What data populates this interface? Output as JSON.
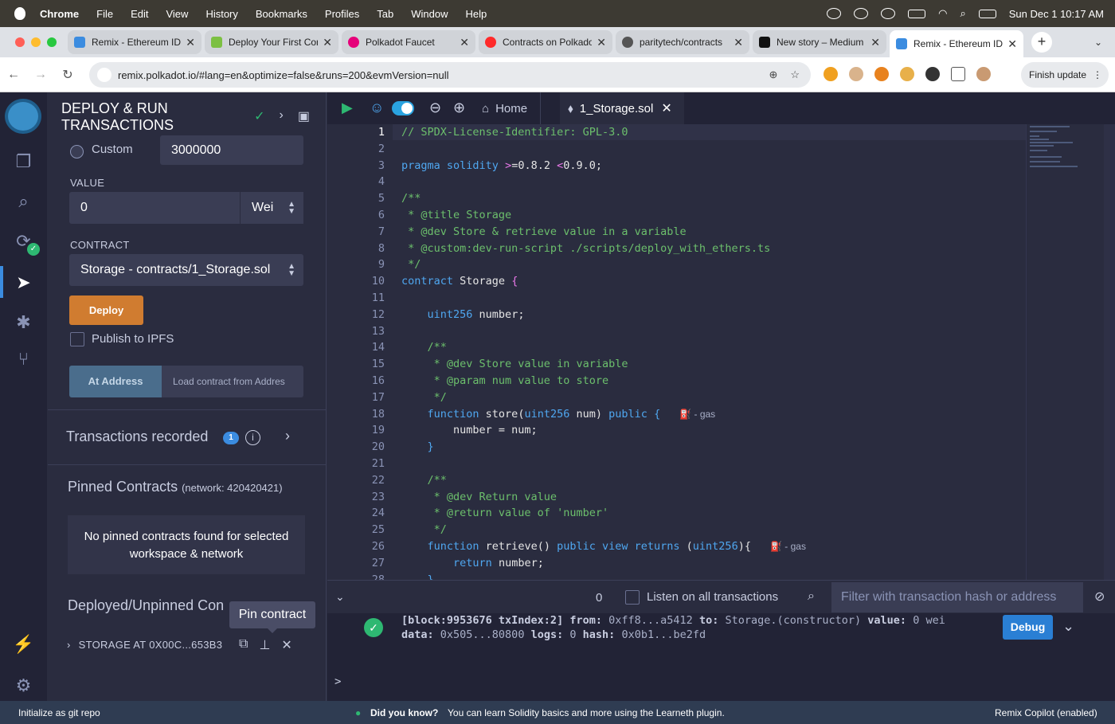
{
  "menubar": {
    "app": "Chrome",
    "items": [
      "File",
      "Edit",
      "View",
      "History",
      "Bookmarks",
      "Profiles",
      "Tab",
      "Window",
      "Help"
    ],
    "datetime": "Sun Dec 1  10:17 AM"
  },
  "tabs": [
    {
      "title": "Remix - Ethereum IDE",
      "color": "#3b8ce0"
    },
    {
      "title": "Deploy Your First Contract",
      "color": "#7cc042"
    },
    {
      "title": "Polkadot Faucet",
      "color": "#e6007a"
    },
    {
      "title": "Contracts on Polkadot",
      "color": "#ff2a2a"
    },
    {
      "title": "paritytech/contracts",
      "color": "#555555"
    },
    {
      "title": "New story – Medium",
      "color": "#111111"
    },
    {
      "title": "Remix - Ethereum IDE",
      "color": "#3b8ce0"
    }
  ],
  "address": {
    "url": "remix.polkadot.io/#lang=en&optimize=false&runs=200&evmVersion=null",
    "finish_update": "Finish update"
  },
  "panel": {
    "title": "DEPLOY & RUN TRANSACTIONS",
    "gas_custom_label": "Custom",
    "gas_value": "3000000",
    "value_label": "VALUE",
    "value_amount": "0",
    "value_unit": "Wei",
    "contract_label": "CONTRACT",
    "contract_selected": "Storage - contracts/1_Storage.sol",
    "deploy_label": "Deploy",
    "publish_ipfs": "Publish to IPFS",
    "at_address": "At Address",
    "load_placeholder": "Load contract from Addres",
    "transactions_recorded": "Transactions recorded",
    "transactions_count": "1",
    "pinned_title": "Pinned Contracts",
    "pinned_network": "(network: 420420421)",
    "no_pinned": "No pinned contracts found for selected workspace & network",
    "deployed_title": "Deployed/Unpinned Con",
    "pin_tooltip": "Pin contract",
    "instance": "STORAGE AT 0X00C...653B3"
  },
  "editor": {
    "home_tab": "Home",
    "file_tab": "1_Storage.sol",
    "gas_hint": "- gas"
  },
  "terminal": {
    "count": "0",
    "listen_label": "Listen on all transactions",
    "filter_placeholder": "Filter with transaction hash or address",
    "line1_block": "[block:9953676 txIndex:2]",
    "line1_from_label": "from:",
    "line1_from": "0xff8...a5412",
    "line1_to_label": "to:",
    "line1_to": "Storage.(constructor)",
    "line1_value_label": "value:",
    "line1_value": "0 wei",
    "line2_data_label": "data:",
    "line2_data": "0x505...80800",
    "line2_logs_label": "logs:",
    "line2_logs": "0",
    "line2_hash_label": "hash:",
    "line2_hash": "0x0b1...be2fd",
    "debug_label": "Debug",
    "prompt": ">"
  },
  "status": {
    "git": "Initialize as git repo",
    "tip_label": "Did you know?",
    "tip_text": "You can learn Solidity basics and more using the Learneth plugin.",
    "copilot": "Remix Copilot (enabled)"
  }
}
